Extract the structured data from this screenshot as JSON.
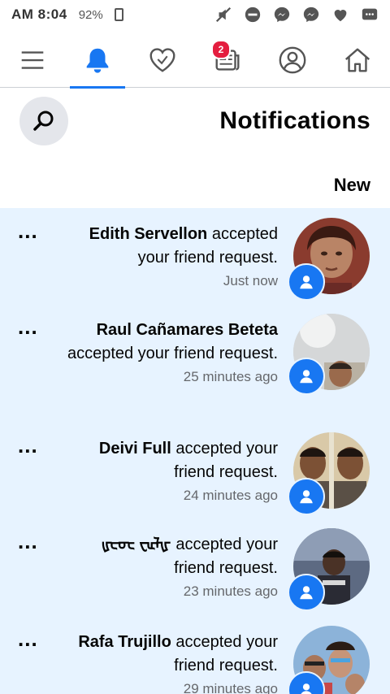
{
  "status_bar": {
    "time": "AM 8:04",
    "battery": "92%"
  },
  "tabs": [
    {
      "icon": "menu-icon",
      "active": false
    },
    {
      "icon": "bell-icon",
      "active": true
    },
    {
      "icon": "heart-icon",
      "active": false
    },
    {
      "icon": "newsfeed-icon",
      "active": false,
      "badge": "2"
    },
    {
      "icon": "profile-icon",
      "active": false
    },
    {
      "icon": "home-icon",
      "active": false
    }
  ],
  "header": {
    "title": "Notifications",
    "section_label": "New"
  },
  "notifications": [
    {
      "name": "Edith Servellon",
      "text": "accepted your friend request.",
      "time": "Just now"
    },
    {
      "name": "Raul Cañamares Beteta",
      "text": "accepted your friend request.",
      "time": "25 minutes ago"
    },
    {
      "name": "Deivi Full",
      "text": "accepted your friend request.",
      "time": "24 minutes ago"
    },
    {
      "name": "ᡁᡄᡉᡄ ᠸᡅᡀ",
      "text": "accepted your friend request.",
      "time": "23 minutes ago"
    },
    {
      "name": "Rafa Trujillo",
      "text": "accepted your friend request.",
      "time": "29 minutes ago"
    }
  ],
  "more_label": "...",
  "colors": {
    "accent": "#1877f2",
    "badge": "#e41e3f",
    "unread_bg": "#e7f3ff"
  }
}
